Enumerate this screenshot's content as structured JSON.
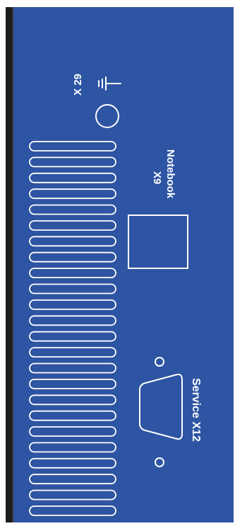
{
  "panel": {
    "colors": {
      "panel_blue": "#2e55a3",
      "edge_black": "#1c1c1c",
      "marking_white": "#ffffff"
    },
    "ground_connector": {
      "label": "X 29",
      "icon": "ground-symbol-icon",
      "socket_icon": "circle-socket-icon"
    },
    "notebook_port": {
      "name": "Notebook",
      "port": "X9",
      "icon": "square-port-outline-icon"
    },
    "service_port": {
      "label": "Service X12",
      "icon": "d-sub-connector-icon"
    },
    "ventilation": {
      "slot_count": 24,
      "icon": "vent-slot-icon"
    }
  }
}
